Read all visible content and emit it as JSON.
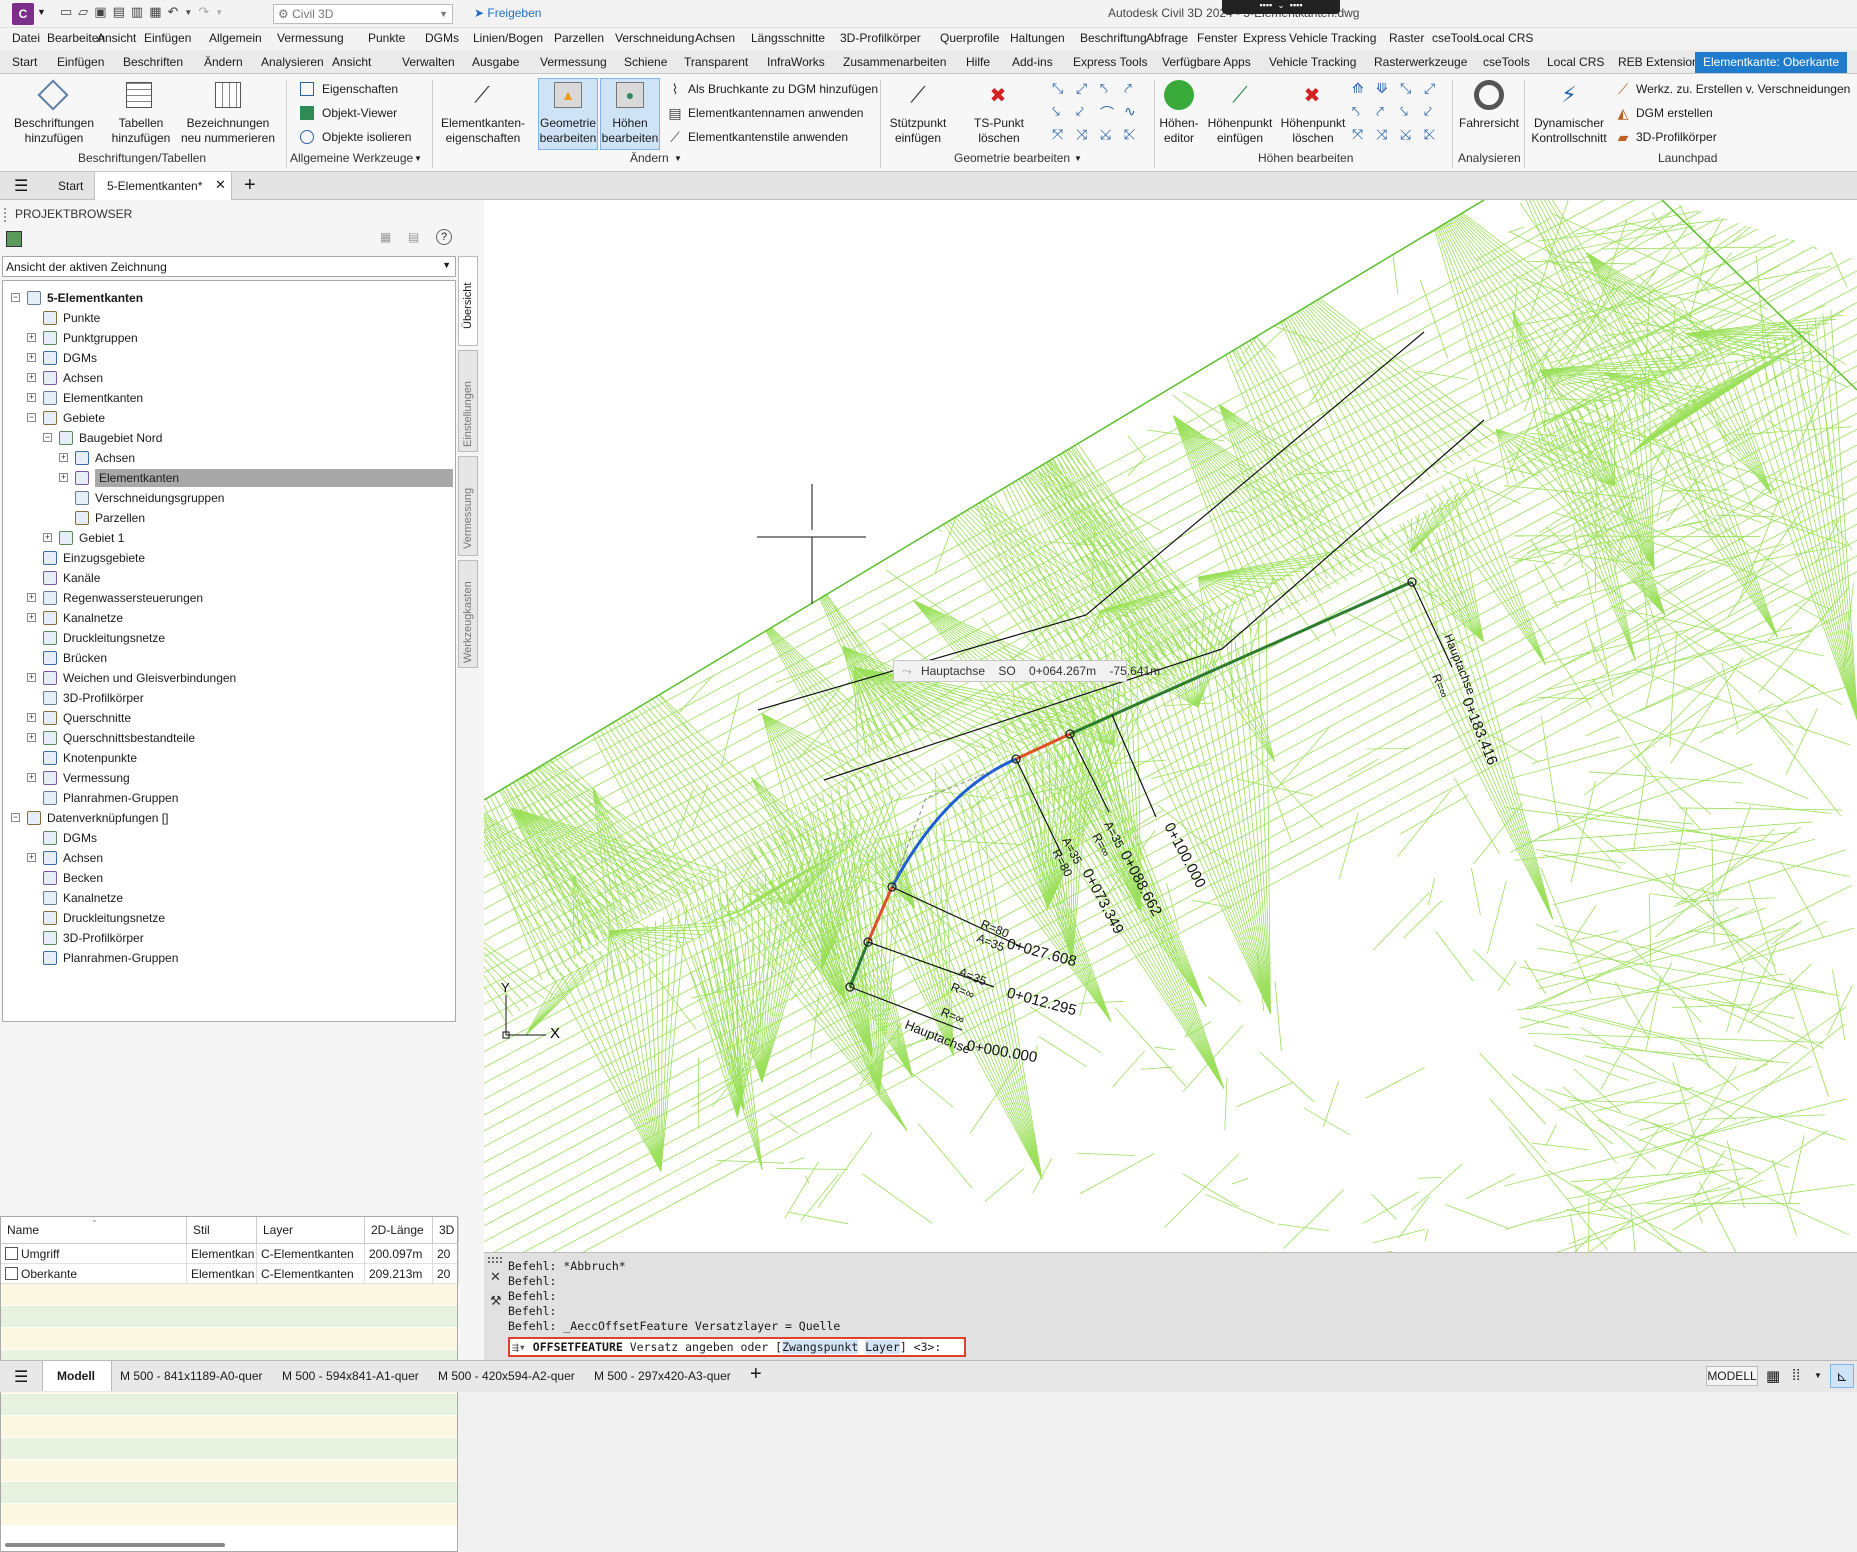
{
  "app": {
    "title": "Autodesk Civil 3D 2024 - 5-Elementkanten.dwg",
    "workspace": "Civil 3D",
    "share_label": "Freigeben"
  },
  "menu": [
    "Datei",
    "Bearbeiten",
    "Ansicht",
    "Einfügen",
    "Allgemein",
    "Vermessung",
    "Punkte",
    "DGMs",
    "Linien/Bogen",
    "Parzellen",
    "Verschneidung",
    "Achsen",
    "Längsschnitte",
    "3D-Profilkörper",
    "Querprofile",
    "Haltungen",
    "Beschriftung",
    "Abfrage",
    "Fenster",
    "Express",
    "Vehicle Tracking",
    "Raster",
    "cseTools",
    "Local CRS"
  ],
  "ribbon_tabs": [
    "Start",
    "Einfügen",
    "Beschriften",
    "Ändern",
    "Analysieren",
    "Ansicht",
    "Verwalten",
    "Ausgabe",
    "Vermessung",
    "Schiene",
    "Transparent",
    "InfraWorks",
    "Zusammenarbeiten",
    "Hilfe",
    "Add-ins",
    "Express Tools",
    "Verfügbare Apps",
    "Vehicle Tracking",
    "Rasterwerkzeuge",
    "cseTools",
    "Local CRS",
    "REB Extension",
    "Elementkante: Oberkante"
  ],
  "ribbon": {
    "beschr": {
      "b1": "Beschriftungen\nhinzufügen",
      "b2": "Tabellen\nhinzufügen",
      "b3": "Bezeichnungen\nneu nummerieren",
      "panel": "Beschriftungen/Tabellen"
    },
    "allg": {
      "i1": "Eigenschaften",
      "i2": "Objekt-Viewer",
      "i3": "Objekte isolieren",
      "panel": "Allgemeine Werkzeuge"
    },
    "aendern": {
      "b1": "Elementkanten-\neigenschaften",
      "b2": "Geometrie\nbearbeiten",
      "b3": "Höhen\nbearbeiten",
      "i1": "Als Bruchkante zu DGM hinzufügen",
      "i2": "Elementkantennamen anwenden",
      "i3": "Elementkantenstile anwenden",
      "panel": "Ändern"
    },
    "geom": {
      "b1": "Stützpunkt\neinfügen",
      "b2": "TS-Punkt löschen",
      "panel": "Geometrie bearbeiten"
    },
    "hoehen": {
      "b1": "Höhen-\neditor",
      "b2": "Höhenpunkt\neinfügen",
      "b3": "Höhenpunkt\nlöschen",
      "panel": "Höhen bearbeiten"
    },
    "analys": {
      "b1": "Fahrersicht",
      "panel": "Analysieren"
    },
    "launch": {
      "b1": "Dynamischer\nKontrollschnitt",
      "i1": "Werkz. zu. Erstellen v. Verschneidungen",
      "i2": "DGM erstellen",
      "i3": "3D-Profilkörper",
      "panel": "Launchpad"
    }
  },
  "doctabs": {
    "start": "Start",
    "active": "5-Elementkanten*"
  },
  "browser": {
    "title": "PROJEKTBROWSER",
    "view": "Ansicht der aktiven Zeichnung",
    "side_tabs": [
      "Übersicht",
      "Einstellungen",
      "Vermessung",
      "Werkzeugkasten"
    ],
    "tree": [
      {
        "d": 0,
        "t": "5-Elementkanten",
        "e": "-",
        "b": true
      },
      {
        "d": 1,
        "t": "Punkte",
        "e": ""
      },
      {
        "d": 1,
        "t": "Punktgruppen",
        "e": "+"
      },
      {
        "d": 1,
        "t": "DGMs",
        "e": "+"
      },
      {
        "d": 1,
        "t": "Achsen",
        "e": "+"
      },
      {
        "d": 1,
        "t": "Elementkanten",
        "e": "+"
      },
      {
        "d": 1,
        "t": "Gebiete",
        "e": "-"
      },
      {
        "d": 2,
        "t": "Baugebiet Nord",
        "e": "-"
      },
      {
        "d": 3,
        "t": "Achsen",
        "e": "+"
      },
      {
        "d": 3,
        "t": "Elementkanten",
        "e": "+",
        "sel": true
      },
      {
        "d": 3,
        "t": "Verschneidungsgruppen",
        "e": ""
      },
      {
        "d": 3,
        "t": "Parzellen",
        "e": ""
      },
      {
        "d": 2,
        "t": "Gebiet 1",
        "e": "+"
      },
      {
        "d": 1,
        "t": "Einzugsgebiete",
        "e": ""
      },
      {
        "d": 1,
        "t": "Kanäle",
        "e": ""
      },
      {
        "d": 1,
        "t": "Regenwassersteuerungen",
        "e": "+"
      },
      {
        "d": 1,
        "t": "Kanalnetze",
        "e": "+"
      },
      {
        "d": 1,
        "t": "Druckleitungsnetze",
        "e": ""
      },
      {
        "d": 1,
        "t": "Brücken",
        "e": ""
      },
      {
        "d": 1,
        "t": "Weichen und Gleisverbindungen",
        "e": "+"
      },
      {
        "d": 1,
        "t": "3D-Profilkörper",
        "e": ""
      },
      {
        "d": 1,
        "t": "Querschnitte",
        "e": "+"
      },
      {
        "d": 1,
        "t": "Querschnittsbestandteile",
        "e": "+"
      },
      {
        "d": 1,
        "t": "Knotenpunkte",
        "e": ""
      },
      {
        "d": 1,
        "t": "Vermessung",
        "e": "+"
      },
      {
        "d": 1,
        "t": "Planrahmen-Gruppen",
        "e": ""
      },
      {
        "d": 0,
        "t": "Datenverknüpfungen []",
        "e": "-"
      },
      {
        "d": 1,
        "t": "DGMs",
        "e": ""
      },
      {
        "d": 1,
        "t": "Achsen",
        "e": "+"
      },
      {
        "d": 1,
        "t": "Becken",
        "e": ""
      },
      {
        "d": 1,
        "t": "Kanalnetze",
        "e": ""
      },
      {
        "d": 1,
        "t": "Druckleitungsnetze",
        "e": ""
      },
      {
        "d": 1,
        "t": "3D-Profilkörper",
        "e": ""
      },
      {
        "d": 1,
        "t": "Planrahmen-Gruppen",
        "e": ""
      }
    ],
    "table": {
      "columns": [
        "Name",
        "Stil",
        "Layer",
        "2D-Länge",
        "3D"
      ],
      "rows": [
        [
          "Umgriff",
          "Elementkan",
          "C-Elementkanten",
          "200.097m",
          "20"
        ],
        [
          "Oberkante",
          "Elementkan",
          "C-Elementkanten",
          "209.213m",
          "20"
        ]
      ]
    }
  },
  "viewport": {
    "tooltip": {
      "axis": "Hauptachse",
      "side": "SO",
      "station": "0+064.267m",
      "offset": "-75.641m"
    },
    "labels": [
      "Hauptachse",
      "R=∞",
      "0+000.000",
      "A=35",
      "R=∞",
      "0+012.295",
      "R=80",
      "A=35",
      "0+027.608",
      "A=35",
      "R=80",
      "0+073.349",
      "A=35",
      "R=∞",
      "0+088.662",
      "0+100.000",
      "Hauptachse",
      "R=∞",
      "0+183.416"
    ],
    "ucs": {
      "x": "X",
      "y": "Y"
    }
  },
  "command": {
    "history": [
      "Befehl: *Abbruch*",
      "Befehl:",
      "Befehl:",
      "Befehl:",
      "Befehl: _AeccOffsetFeature Versatzlayer = Quelle"
    ],
    "cmd": "OFFSETFEATURE",
    "prompt": "Versatz angeben oder [",
    "opt1": "Zwangspunkt",
    "opt2": "Layer",
    "tail": "] <3>:"
  },
  "status": {
    "layouts": [
      "Modell",
      "M 500 - 841x1189-A0-quer",
      "M 500 - 594x841-A1-quer",
      "M 500 - 420x594-A2-quer",
      "M 500 - 297x420-A3-quer"
    ],
    "mode": "MODELL"
  }
}
